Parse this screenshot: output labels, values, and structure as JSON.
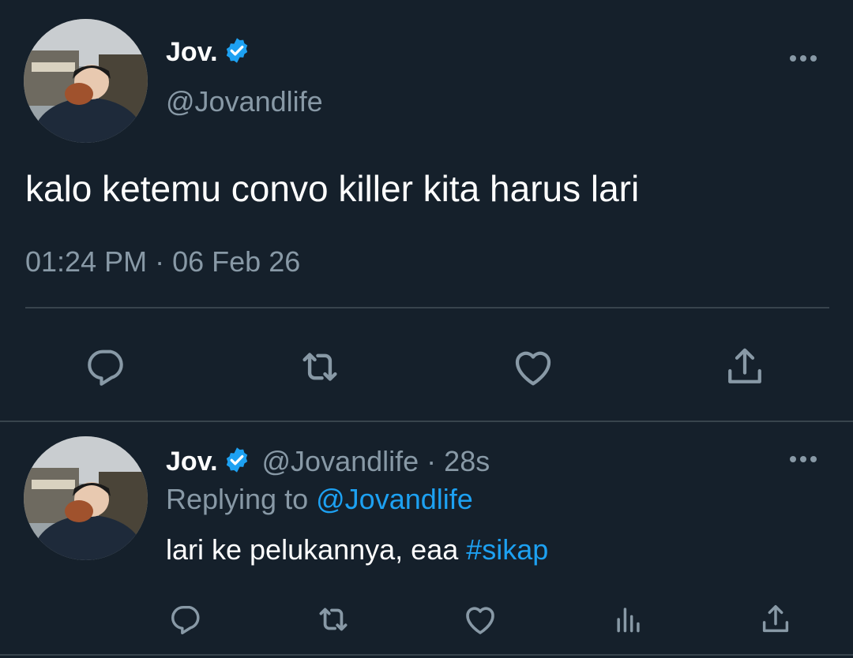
{
  "main_tweet": {
    "display_name": "Jov.",
    "handle": "@Jovandlife",
    "text": "kalo ketemu convo killer kita harus lari",
    "timestamp": "01:24 PM",
    "separator": "·",
    "date": "06 Feb 26",
    "actions": [
      "reply-icon",
      "retweet-icon",
      "like-icon",
      "share-icon"
    ]
  },
  "reply_tweet": {
    "display_name": "Jov.",
    "handle": "@Jovandlife",
    "separator": "·",
    "time_ago": "28s",
    "replying_label": "Replying to",
    "replying_handle": "@Jovandlife",
    "text": "lari ke pelukannya, eaa",
    "hashtag": "#sikap",
    "actions": [
      "reply-icon",
      "retweet-icon",
      "like-icon",
      "analytics-icon",
      "share-icon"
    ]
  },
  "colors": {
    "background": "#15202b",
    "text_primary": "#ffffff",
    "text_secondary": "#8899a6",
    "accent": "#1da1f2",
    "divider": "#38444d"
  }
}
